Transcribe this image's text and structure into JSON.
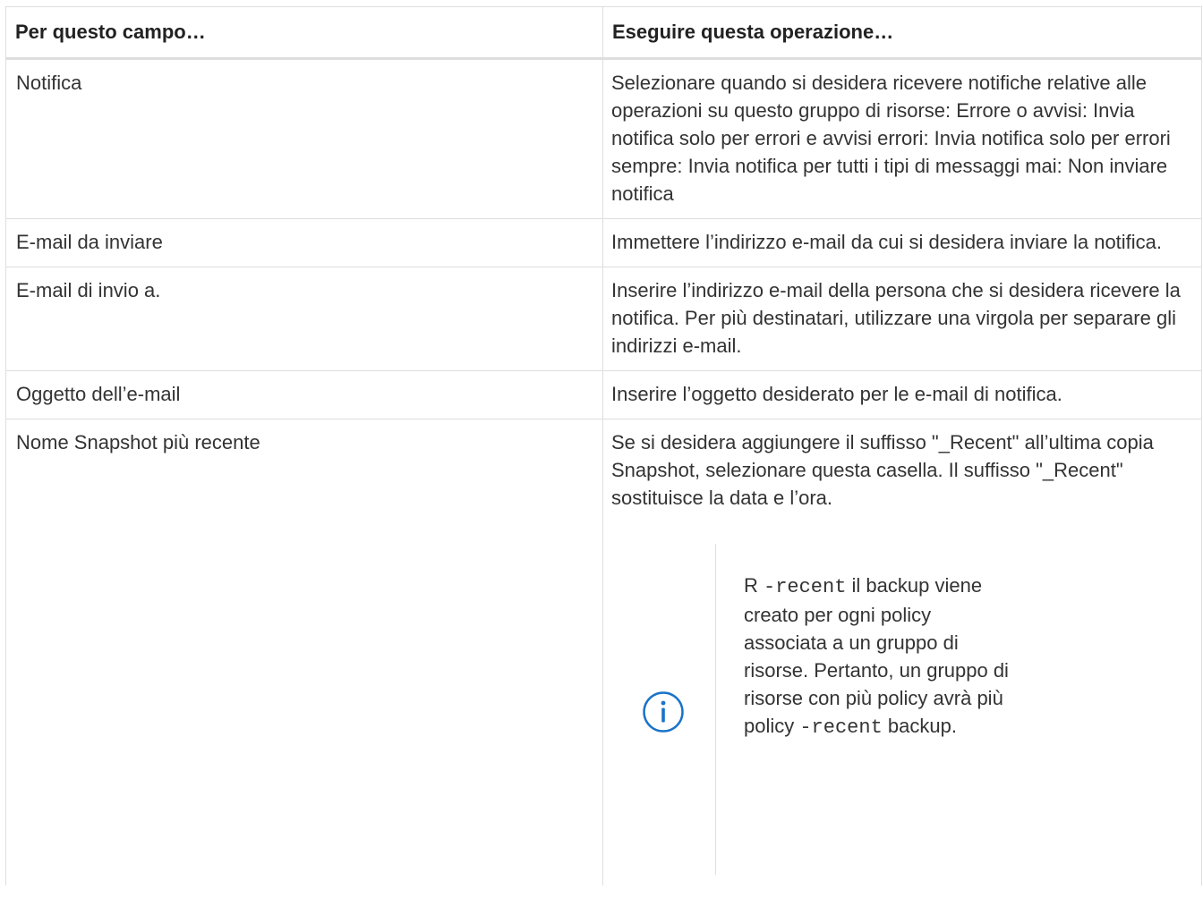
{
  "table": {
    "headers": [
      "Per questo campo…",
      "Eseguire questa operazione…"
    ],
    "rows": [
      {
        "field": "Notifica",
        "description": "Selezionare quando si desidera ricevere notifiche relative alle operazioni su questo gruppo di risorse: Errore o avvisi: Invia notifica solo per errori e avvisi errori: Invia notifica solo per errori sempre: Invia notifica per tutti i tipi di messaggi mai: Non inviare notifica"
      },
      {
        "field": "E-mail da inviare",
        "description": "Immettere l’indirizzo e-mail da cui si desidera inviare la notifica."
      },
      {
        "field": "E-mail di invio a.",
        "description": "Inserire l’indirizzo e-mail della persona che si desidera ricevere la notifica. Per più destinatari, utilizzare una virgola per separare gli indirizzi e-mail."
      },
      {
        "field": "Oggetto dell’e-mail",
        "description": "Inserire l’oggetto desiderato per le e-mail di notifica."
      },
      {
        "field": "Nome Snapshot più recente",
        "description": "Se si desidera aggiungere il suffisso \"_Recent\" all’ultima copia Snapshot, selezionare questa casella. Il suffisso \"_Recent\" sostituisce la data e l’ora.",
        "note": {
          "icon": "info-circle-icon",
          "prefix": "R ",
          "code1": "-recent",
          "middle": " il backup viene creato per ogni policy associata a un gruppo di risorse. Pertanto, un gruppo di risorse con più policy avrà più policy ",
          "code2": "-recent",
          "suffix": " backup."
        }
      }
    ]
  },
  "colors": {
    "text": "#333333",
    "border": "#dedede",
    "icon": "#1a73c9"
  }
}
